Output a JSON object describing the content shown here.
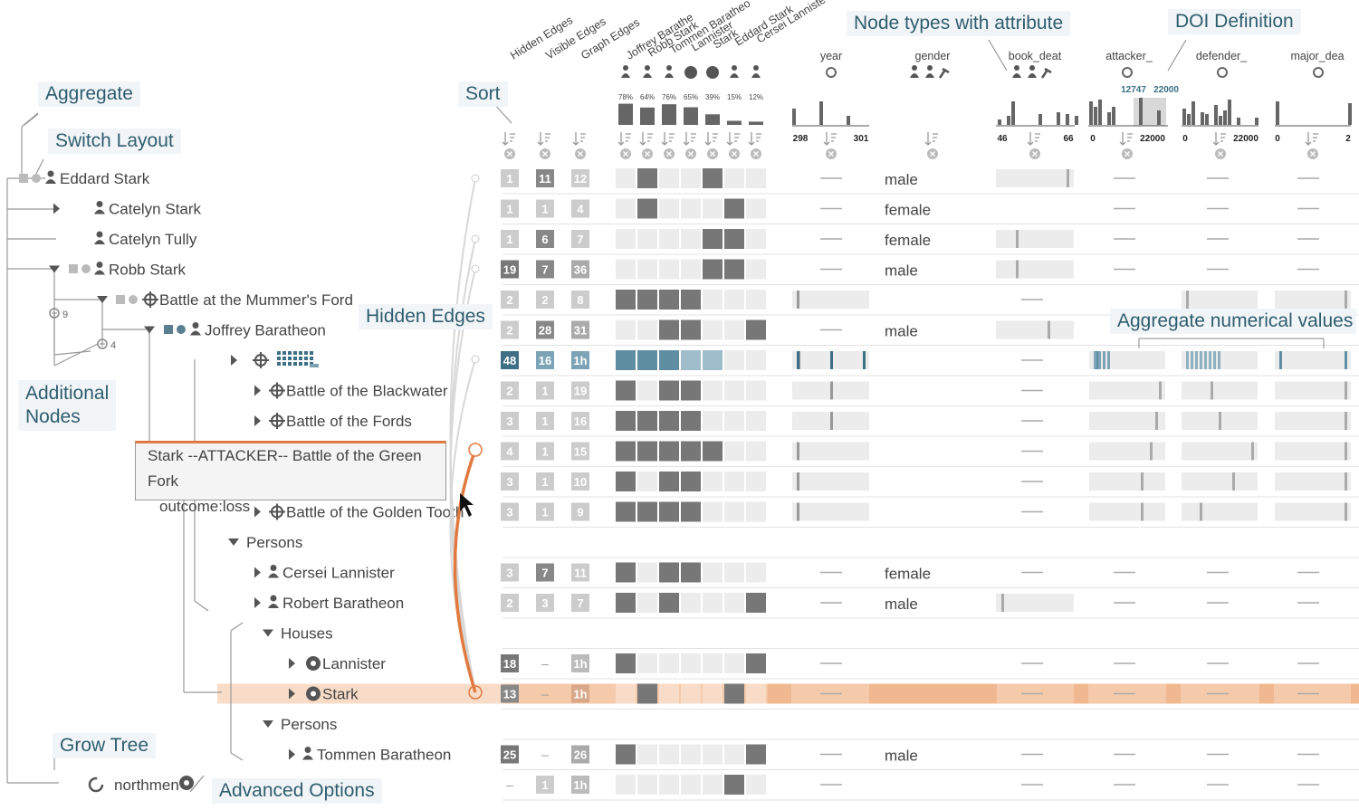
{
  "callouts": {
    "aggregate": "Aggregate",
    "switch_layout": "Switch Layout",
    "sort": "Sort",
    "hidden_edges": "Hidden Edges",
    "additional_nodes": "Additional\nNodes",
    "grow_tree": "Grow Tree",
    "advanced_options": "Advanced Options",
    "node_types": "Node types with attribute",
    "doi_definition": "DOI Definition",
    "aggregate_numerical": "Aggregate numerical values"
  },
  "column_headers": [
    "Hidden Edges",
    "Visible Edges",
    "Graph Edges",
    "Joffrey Barathe",
    "Robb Stark",
    "Tommen Baratheo",
    "Lannister",
    "Stark",
    "Eddard Stark",
    "Cersei Lanniste"
  ],
  "attribute_headers": [
    "year",
    "gender",
    "book_deat",
    "attacker_",
    "defender_",
    "major_dea"
  ],
  "percentages": [
    "78%",
    "64%",
    "76%",
    "65%",
    "39%",
    "15%",
    "12%"
  ],
  "axis_labels": {
    "year_min": "298",
    "year_max": "301",
    "book_min": "46",
    "book_max": "66",
    "att_min": "0",
    "att_max": "22000",
    "att_sel_lo": "12747",
    "att_sel_hi": "22000",
    "def_min": "0",
    "def_max": "22000",
    "maj_min": "0",
    "maj_max": "2"
  },
  "tree_rows": [
    {
      "label": "Eddard Stark",
      "icon": "person"
    },
    {
      "label": "Catelyn Stark",
      "icon": "person"
    },
    {
      "label": "Catelyn Tully",
      "icon": "person"
    },
    {
      "label": "Robb Stark",
      "icon": "person"
    },
    {
      "label": "Battle at the Mummer's Ford",
      "icon": "battle"
    },
    {
      "label": "Joffrey Baratheon",
      "icon": "person"
    },
    {
      "label": "",
      "icon": "battle"
    },
    {
      "label": "Battle of the Blackwater",
      "icon": "battle"
    },
    {
      "label": "Battle of the Fords",
      "icon": "battle"
    },
    {
      "label": "",
      "icon": ""
    },
    {
      "label": "",
      "icon": ""
    },
    {
      "label": "Battle of the Golden Tooth",
      "icon": "battle"
    },
    {
      "label": "Persons",
      "icon": ""
    },
    {
      "label": "Cersei Lannister",
      "icon": "person"
    },
    {
      "label": "Robert Baratheon",
      "icon": "person"
    },
    {
      "label": "Houses",
      "icon": ""
    },
    {
      "label": "Lannister",
      "icon": "house"
    },
    {
      "label": "Stark",
      "icon": "house"
    },
    {
      "label": "Persons",
      "icon": ""
    },
    {
      "label": "Tommen Baratheon",
      "icon": "person"
    },
    {
      "label": "northmen",
      "icon": "spinner"
    }
  ],
  "additional_counts": [
    "9",
    "4"
  ],
  "edge_counts": [
    [
      "1",
      "11",
      "12"
    ],
    [
      "1",
      "1",
      "4"
    ],
    [
      "1",
      "6",
      "7"
    ],
    [
      "19",
      "7",
      "36"
    ],
    [
      "2",
      "2",
      "8"
    ],
    [
      "2",
      "28",
      "31"
    ],
    [
      "48",
      "16",
      "1h"
    ],
    [
      "2",
      "1",
      "19"
    ],
    [
      "3",
      "1",
      "16"
    ],
    [
      "4",
      "1",
      "15"
    ],
    [
      "3",
      "1",
      "10"
    ],
    [
      "3",
      "1",
      "9"
    ],
    [
      "",
      "",
      ""
    ],
    [
      "3",
      "7",
      "11"
    ],
    [
      "2",
      "3",
      "7"
    ],
    [
      "",
      "",
      ""
    ],
    [
      "18",
      "–",
      "1h"
    ],
    [
      "13",
      "–",
      "1h"
    ],
    [
      "",
      "",
      ""
    ],
    [
      "25",
      "–",
      "26"
    ],
    [
      "–",
      "1",
      "1h"
    ]
  ],
  "gender_values": [
    "male",
    "female",
    "female",
    "male",
    "",
    "male",
    "",
    "",
    "",
    "",
    "",
    "",
    "",
    "female",
    "male",
    "",
    "",
    "",
    "",
    "male",
    ""
  ],
  "tooltip": {
    "line1": "Stark --ATTACKER-- Battle of the Green Fork",
    "line2": "outcome:loss"
  },
  "colors": {
    "highlight": "#f4c7a6",
    "accent": "#e07a3e",
    "bar": "#777777",
    "callout_text": "#2e5d6e",
    "selected": "#5f8ea3"
  }
}
